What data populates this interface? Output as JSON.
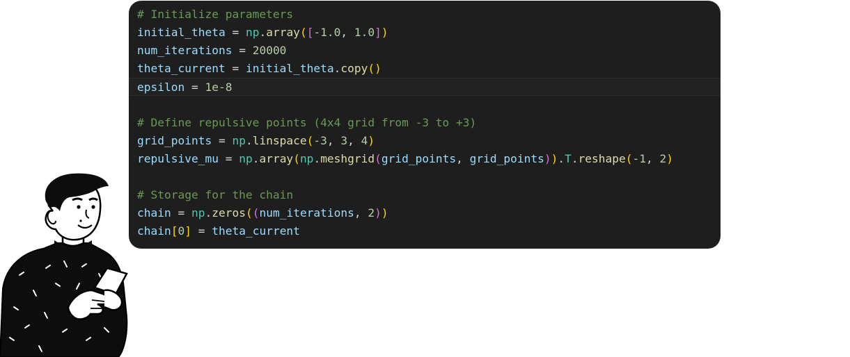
{
  "code": {
    "language": "python",
    "active_line": 5,
    "lines": [
      [
        {
          "t": "# Initialize parameters",
          "c": "comment"
        }
      ],
      [
        {
          "t": "initial_theta",
          "c": "var"
        },
        {
          "t": " = ",
          "c": "op"
        },
        {
          "t": "np",
          "c": "mod"
        },
        {
          "t": ".",
          "c": "op"
        },
        {
          "t": "array",
          "c": "fn"
        },
        {
          "t": "(",
          "c": "b1"
        },
        {
          "t": "[",
          "c": "b2"
        },
        {
          "t": "-1.0",
          "c": "num"
        },
        {
          "t": ", ",
          "c": "op"
        },
        {
          "t": "1.0",
          "c": "num"
        },
        {
          "t": "]",
          "c": "b2"
        },
        {
          "t": ")",
          "c": "b1"
        }
      ],
      [
        {
          "t": "num_iterations",
          "c": "var"
        },
        {
          "t": " = ",
          "c": "op"
        },
        {
          "t": "20000",
          "c": "num"
        }
      ],
      [
        {
          "t": "theta_current",
          "c": "var"
        },
        {
          "t": " = ",
          "c": "op"
        },
        {
          "t": "initial_theta",
          "c": "var"
        },
        {
          "t": ".",
          "c": "op"
        },
        {
          "t": "copy",
          "c": "fn"
        },
        {
          "t": "()",
          "c": "b1"
        }
      ],
      [
        {
          "t": "epsilon",
          "c": "var"
        },
        {
          "t": " = ",
          "c": "op"
        },
        {
          "t": "1e-8",
          "c": "num"
        }
      ],
      [],
      [
        {
          "t": "# Define repulsive points (4x4 grid from -3 to +3)",
          "c": "comment"
        }
      ],
      [
        {
          "t": "grid_points",
          "c": "var"
        },
        {
          "t": " = ",
          "c": "op"
        },
        {
          "t": "np",
          "c": "mod"
        },
        {
          "t": ".",
          "c": "op"
        },
        {
          "t": "linspace",
          "c": "fn"
        },
        {
          "t": "(",
          "c": "b1"
        },
        {
          "t": "-3",
          "c": "num"
        },
        {
          "t": ", ",
          "c": "op"
        },
        {
          "t": "3",
          "c": "num"
        },
        {
          "t": ", ",
          "c": "op"
        },
        {
          "t": "4",
          "c": "num"
        },
        {
          "t": ")",
          "c": "b1"
        }
      ],
      [
        {
          "t": "repulsive_mu",
          "c": "var"
        },
        {
          "t": " = ",
          "c": "op"
        },
        {
          "t": "np",
          "c": "mod"
        },
        {
          "t": ".",
          "c": "op"
        },
        {
          "t": "array",
          "c": "fn"
        },
        {
          "t": "(",
          "c": "b1"
        },
        {
          "t": "np",
          "c": "mod"
        },
        {
          "t": ".",
          "c": "op"
        },
        {
          "t": "meshgrid",
          "c": "fn"
        },
        {
          "t": "(",
          "c": "b2"
        },
        {
          "t": "grid_points",
          "c": "var"
        },
        {
          "t": ", ",
          "c": "op"
        },
        {
          "t": "grid_points",
          "c": "var"
        },
        {
          "t": ")",
          "c": "b2"
        },
        {
          "t": ")",
          "c": "b1"
        },
        {
          "t": ".",
          "c": "op"
        },
        {
          "t": "T",
          "c": "mod"
        },
        {
          "t": ".",
          "c": "op"
        },
        {
          "t": "reshape",
          "c": "fn"
        },
        {
          "t": "(",
          "c": "b1"
        },
        {
          "t": "-1",
          "c": "num"
        },
        {
          "t": ", ",
          "c": "op"
        },
        {
          "t": "2",
          "c": "num"
        },
        {
          "t": ")",
          "c": "b1"
        }
      ],
      [],
      [
        {
          "t": "# Storage for the chain",
          "c": "comment"
        }
      ],
      [
        {
          "t": "chain",
          "c": "var"
        },
        {
          "t": " = ",
          "c": "op"
        },
        {
          "t": "np",
          "c": "mod"
        },
        {
          "t": ".",
          "c": "op"
        },
        {
          "t": "zeros",
          "c": "fn"
        },
        {
          "t": "(",
          "c": "b1"
        },
        {
          "t": "(",
          "c": "b2"
        },
        {
          "t": "num_iterations",
          "c": "var"
        },
        {
          "t": ", ",
          "c": "op"
        },
        {
          "t": "2",
          "c": "num"
        },
        {
          "t": ")",
          "c": "b2"
        },
        {
          "t": ")",
          "c": "b1"
        }
      ],
      [
        {
          "t": "chain",
          "c": "var"
        },
        {
          "t": "[",
          "c": "b1"
        },
        {
          "t": "0",
          "c": "num"
        },
        {
          "t": "]",
          "c": "b1"
        },
        {
          "t": " = ",
          "c": "op"
        },
        {
          "t": "theta_current",
          "c": "var"
        }
      ]
    ]
  },
  "colors": {
    "panel_bg": "#1e1e1e",
    "comment": "#6a9955",
    "variable": "#9cdcfe",
    "module": "#4ec9b0",
    "function": "#dcdcaa",
    "number": "#b5cea8",
    "bracket_1": "#ffd700",
    "bracket_2": "#da70d6"
  },
  "illustration": {
    "icon": "person-holding-phone-illustration"
  }
}
